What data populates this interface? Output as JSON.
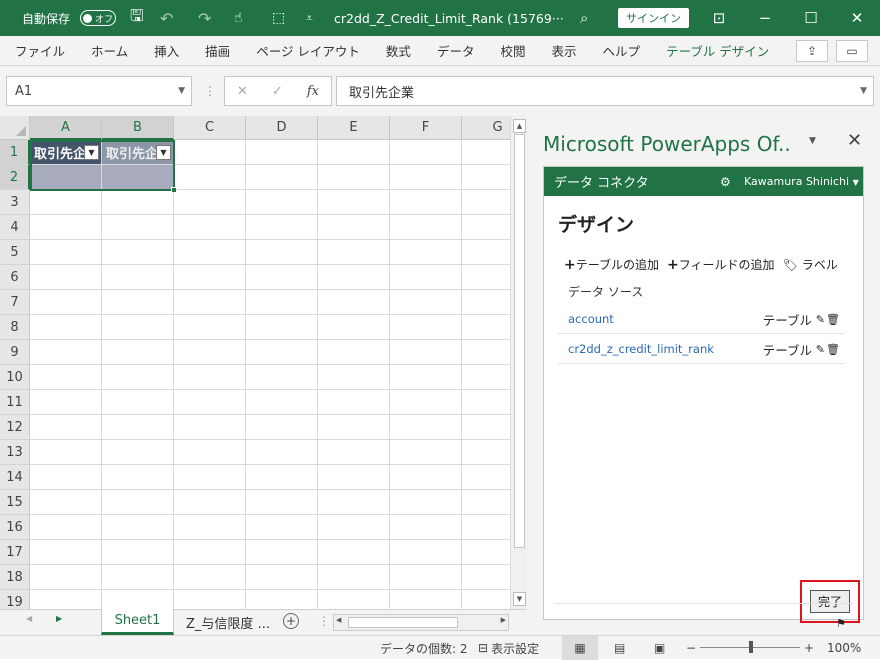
{
  "titlebar": {
    "autosave_label": "自動保存",
    "autosave_state": "オフ",
    "doc_title": "cr2dd_Z_Credit_Limit_Rank (15769···",
    "signin_label": "サインイン",
    "icons": [
      "save-icon",
      "undo-icon",
      "redo-icon",
      "touch-mode-icon",
      "select-icon",
      "customize-icon",
      "search-icon",
      "ribbon-display-icon",
      "minimize-icon",
      "maximize-icon",
      "close-icon"
    ]
  },
  "ribbon": {
    "tabs": [
      "ファイル",
      "ホーム",
      "挿入",
      "描画",
      "ページ レイアウト",
      "数式",
      "データ",
      "校閲",
      "表示",
      "ヘルプ",
      "テーブル デザイン"
    ],
    "active_tab_color": "#217346"
  },
  "formula_bar": {
    "name_box": "A1",
    "fx_label": "fx",
    "formula": "取引先企業"
  },
  "grid": {
    "columns": [
      "A",
      "B",
      "C",
      "D",
      "E",
      "F",
      "G"
    ],
    "rows": [
      "1",
      "2",
      "3",
      "4",
      "5",
      "6",
      "7",
      "8",
      "9",
      "10",
      "11",
      "12",
      "13",
      "14",
      "15",
      "16",
      "17",
      "18",
      "19"
    ],
    "header_cells": [
      "取引先企業",
      "取引先企業"
    ]
  },
  "sheets": {
    "tabs": [
      "Sheet1",
      "Z_与信限度 ..."
    ],
    "active": "Sheet1"
  },
  "statusbar": {
    "count": "データの個数: 2",
    "display_settings": "表示設定",
    "zoom": "100%",
    "zoom_minus": "−",
    "zoom_plus": "+"
  },
  "pane": {
    "title": "Microsoft PowerApps Of..",
    "connector_title": "データ コネクタ",
    "user": "Kawamura Shinichi",
    "design_heading": "デザイン",
    "add_table": "テーブルの追加",
    "add_field": "フィールドの追加",
    "label": "ラベル",
    "datasource_label": "データ ソース",
    "datasources": [
      {
        "name": "account",
        "type": "テーブル"
      },
      {
        "name": "cr2dd_z_credit_limit_rank",
        "type": "テーブル"
      }
    ],
    "done_label": "完了"
  },
  "colors": {
    "brand": "#217346",
    "table_header": "#44546a",
    "highlight": "#e0141e"
  }
}
